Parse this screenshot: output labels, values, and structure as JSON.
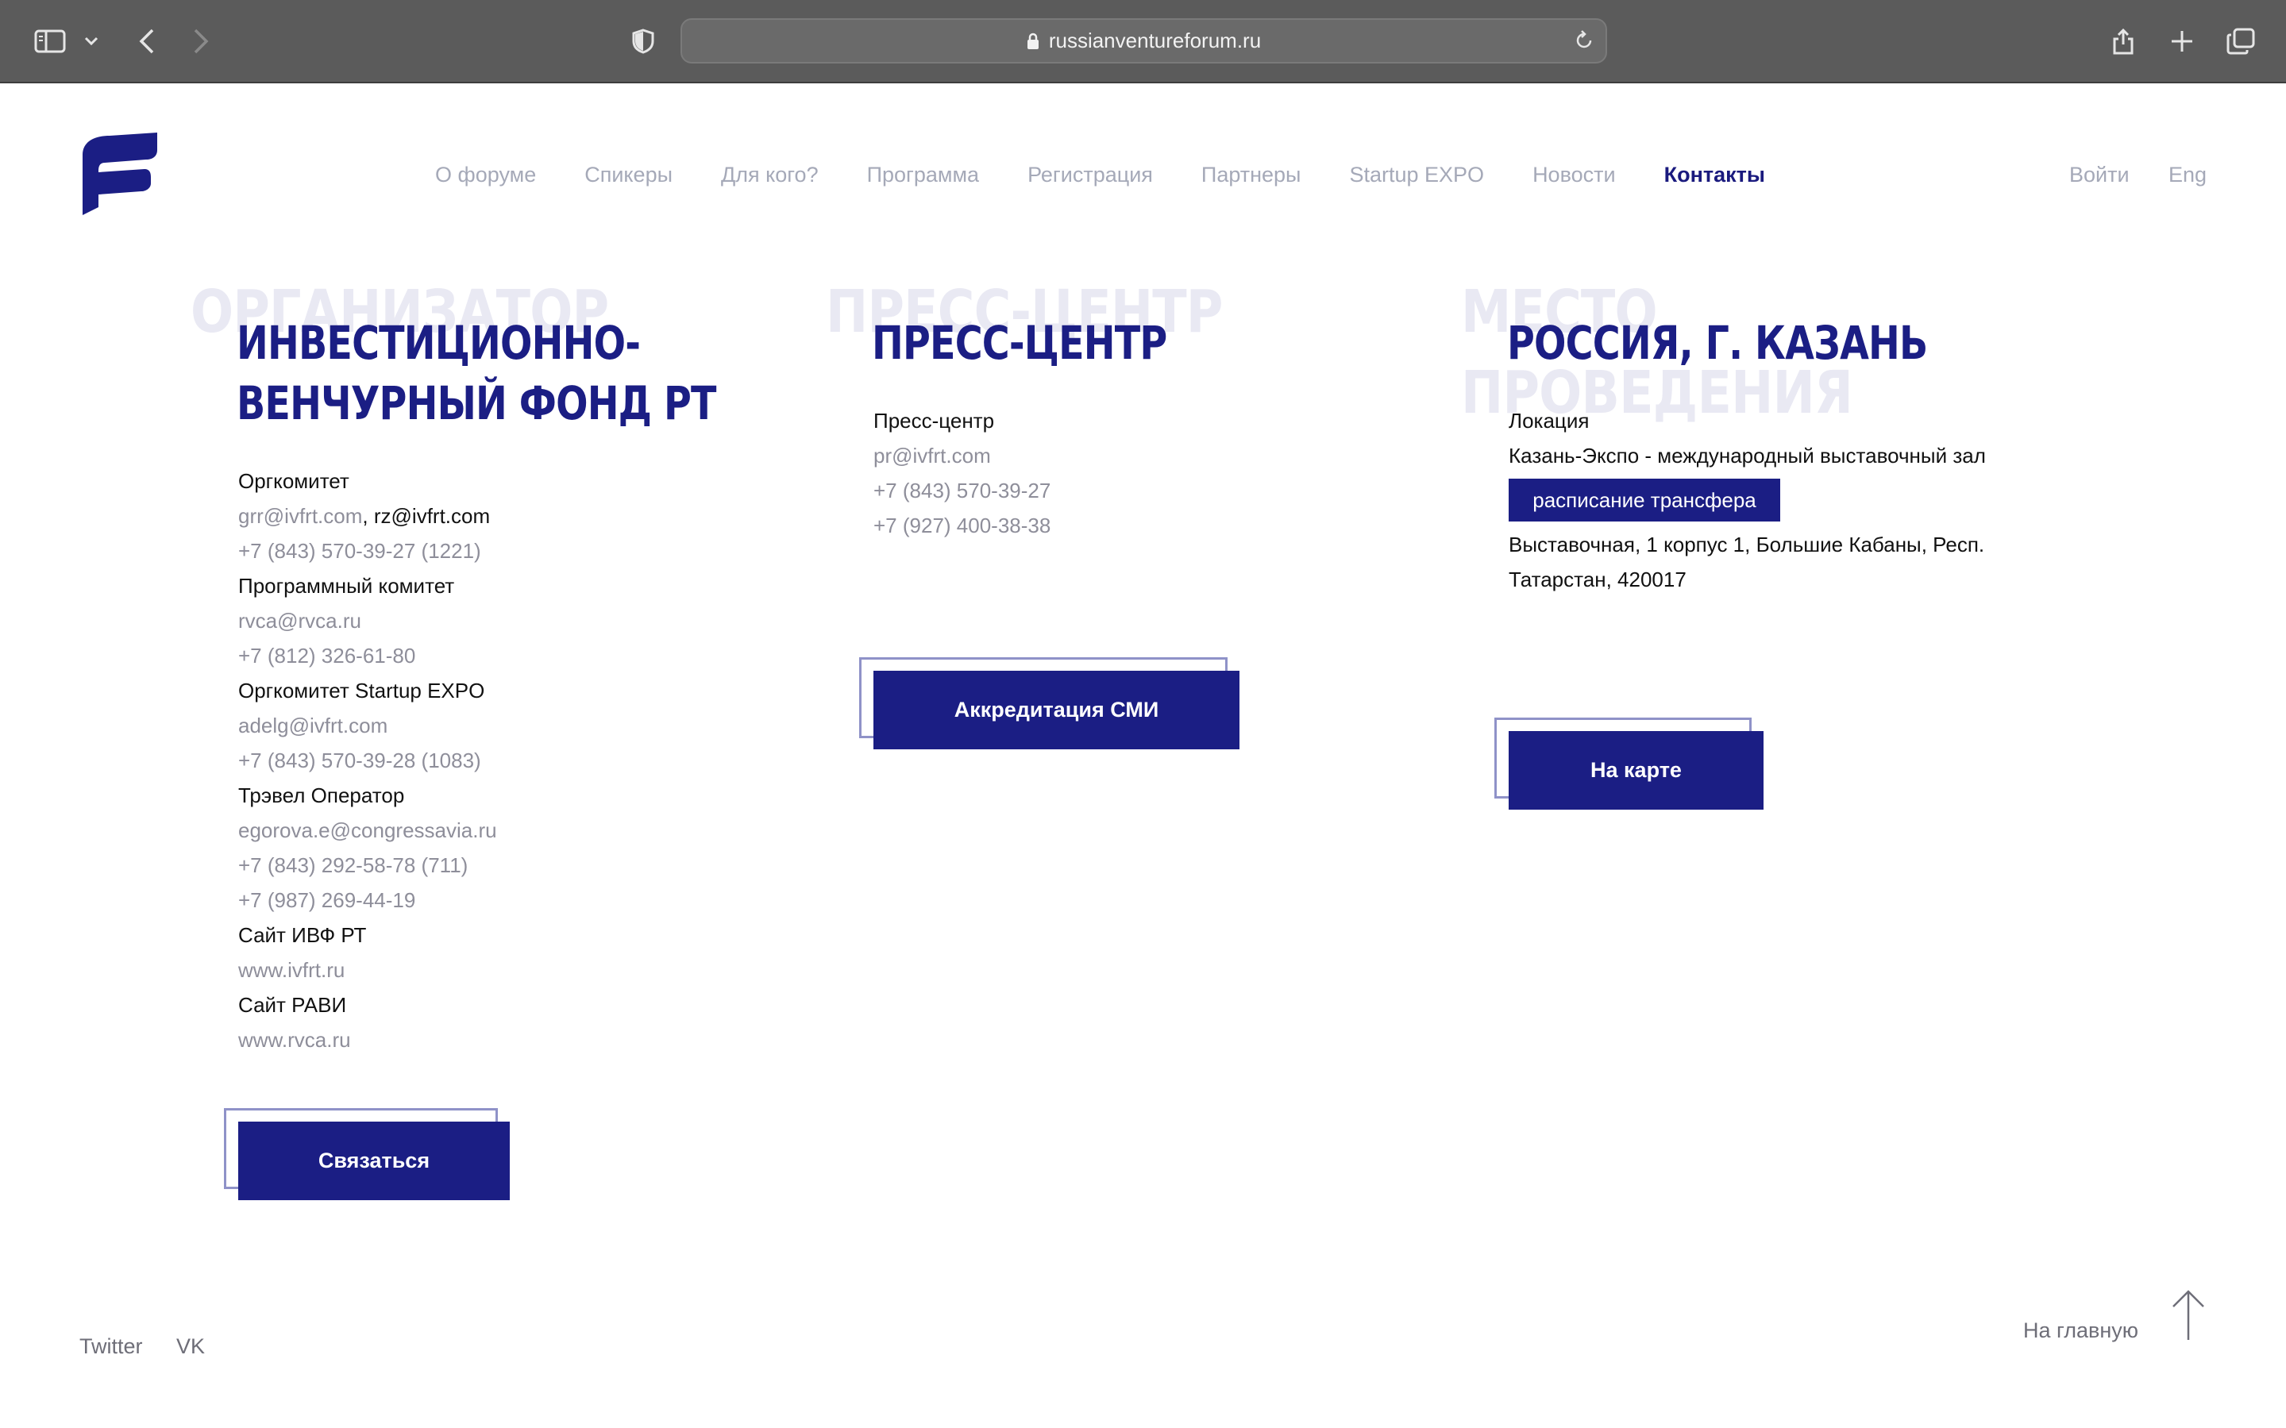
{
  "browser": {
    "url": "russianventureforum.ru",
    "icons": [
      "sidebar-icon",
      "chevron-down-icon",
      "back-icon",
      "forward-icon",
      "shield-icon",
      "lock-icon",
      "reload-icon",
      "share-icon",
      "plus-icon",
      "tabs-icon"
    ]
  },
  "nav": {
    "items": [
      {
        "label": "О форуме"
      },
      {
        "label": "Спикеры"
      },
      {
        "label": "Для кого?"
      },
      {
        "label": "Программа"
      },
      {
        "label": "Регистрация"
      },
      {
        "label": "Партнеры"
      },
      {
        "label": "Startup EXPO"
      },
      {
        "label": "Новости"
      },
      {
        "label": "Контакты",
        "active": true
      }
    ],
    "login": "Войти",
    "lang": "Eng"
  },
  "organizer": {
    "bg_title": "ОРГАНИЗАТОР",
    "title_line1": "ИНВЕСТИЦИОННО-",
    "title_line2": "ВЕНЧУРНЫЙ ФОНД РТ",
    "orgcom_label": "Оргкомитет",
    "orgcom_email1": "grr@ivfrt.com",
    "orgcom_sep": ", ",
    "orgcom_email2": "rz@ivfrt.com",
    "orgcom_phone": "+7 (843) 570-39-27 (1221)",
    "program_label": "Программный комитет",
    "program_email": "rvca@rvca.ru",
    "program_phone": "+7 (812) 326-61-80",
    "expo_label": "Оргкомитет Startup EXPO",
    "expo_email": "adelg@ivfrt.com",
    "expo_phone": "+7 (843) 570-39-28 (1083)",
    "travel_label": "Трэвел Оператор",
    "travel_email": "egorova.e@congressavia.ru",
    "travel_phone1": "+7 (843) 292-58-78 (711)",
    "travel_phone2": "+7 (987) 269-44-19",
    "site1_label": "Сайт ИВФ РТ",
    "site1_url": "www.ivfrt.ru",
    "site2_label": "Сайт РАВИ",
    "site2_url": "www.rvca.ru",
    "button": "Связаться"
  },
  "press": {
    "bg_title": "ПРЕСС-ЦЕНТР",
    "title": "ПРЕСС-ЦЕНТР",
    "label": "Пресс-центр",
    "email": "pr@ivfrt.com",
    "phone1": "+7 (843) 570-39-27",
    "phone2": "+7 (927) 400-38-38",
    "button": "Аккредитация СМИ"
  },
  "venue": {
    "bg_title_line1": "МЕСТО",
    "bg_title_line2": "ПРОВЕДЕНИЯ",
    "title": "РОССИЯ, Г. КАЗАНЬ",
    "location_label": "Локация",
    "location_name": "Казань-Экспо - международный выставочный зал",
    "transfer_button": "расписание трансфера",
    "address_line1": "Выставочная, 1 корпус 1, Большие Кабаны, Респ.",
    "address_line2": "Татарстан, 420017",
    "button": "На карте"
  },
  "footer": {
    "twitter": "Twitter",
    "vk": "VK",
    "home": "На главную"
  },
  "colors": {
    "accent": "#1b1e84",
    "muted_text": "#8e8e9a",
    "nav_text": "#a5a9b8",
    "watermark": "#e9e9f3"
  }
}
